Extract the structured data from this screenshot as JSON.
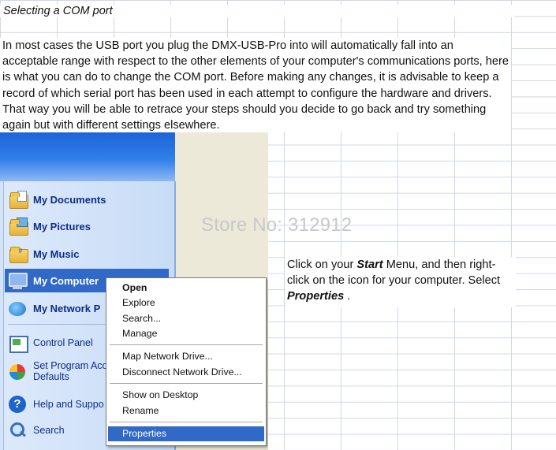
{
  "document": {
    "title": "Selecting a COM port",
    "paragraph": "In most cases the USB port you plug the DMX-USB-Pro into will automatically fall into an acceptable range with respect to the other elements of your computer's communications ports, here is what you can do to change the COM port. Before making any changes, it is advisable to keep a record of which serial port has been used in each attempt to configure the hardware and drivers. That way you will be able to retrace your steps should you decide to go back and try something again but with different settings elsewhere.",
    "watermark": "Store No: 312912",
    "instruction": {
      "part1": "Click on your ",
      "start": "Start",
      "part2": " Menu, and then right-click on the icon for your computer. Select ",
      "properties": "Properties",
      "part3": " ."
    }
  },
  "start_menu": {
    "items": [
      {
        "label": "My Documents",
        "icon": "my-documents-icon"
      },
      {
        "label": "My Pictures",
        "icon": "my-pictures-icon"
      },
      {
        "label": "My Music",
        "icon": "my-music-icon"
      },
      {
        "label": "My Computer",
        "icon": "my-computer-icon"
      },
      {
        "label": "My Network P",
        "icon": "my-network-places-icon"
      },
      {
        "label": "Control Panel",
        "icon": "control-panel-icon"
      },
      {
        "label": "Set Program Acc\nDefaults",
        "icon": "set-program-access-icon"
      },
      {
        "label": "Help and Suppo",
        "icon": "help-icon"
      },
      {
        "label": "Search",
        "icon": "search-icon"
      }
    ]
  },
  "context_menu": {
    "items": [
      "Open",
      "Explore",
      "Search...",
      "Manage",
      "Map Network Drive...",
      "Disconnect Network Drive...",
      "Show on Desktop",
      "Rename",
      "Properties"
    ]
  },
  "colors": {
    "selection": "#316ac5",
    "xp_blue": "#2f7fea",
    "grid": "#d0d7e5"
  }
}
